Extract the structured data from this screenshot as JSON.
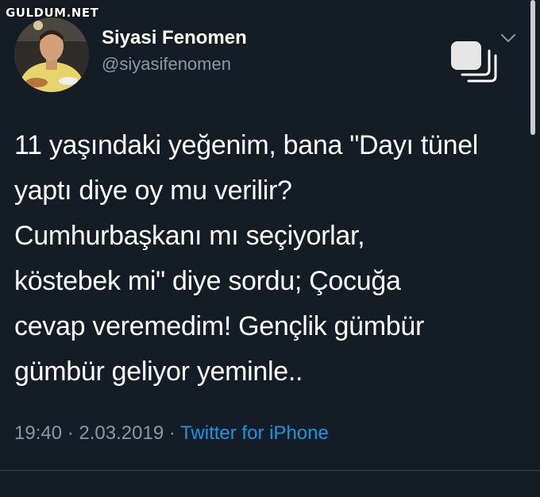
{
  "watermark": "GULDUM.NET",
  "user": {
    "display_name": "Siyasi Fenomen",
    "handle": "@siyasifenomen",
    "avatar_icon": "profile-photo"
  },
  "tweet": {
    "lines": [
      "11 yaşındaki yeğenim, bana \"Dayı tünel",
      "yaptı diye oy mu verilir?",
      "Cumhurbaşkanı mı seçiyorlar,",
      "köstebek mi\" diye sordu; Çocuğa",
      "cevap veremedim! Gençlik gümbür",
      "gümbür geliyor yeminle.."
    ]
  },
  "meta": {
    "time": "19:40",
    "separator1": " · ",
    "date": "2.03.2019",
    "separator2": " · ",
    "source": "Twitter for iPhone"
  },
  "icons": {
    "chevron": "chevron-down-icon",
    "stack": "copy-stack-icon"
  },
  "colors": {
    "background": "#141d26",
    "secondary_text": "#8899a6",
    "link": "#1b95e0"
  }
}
